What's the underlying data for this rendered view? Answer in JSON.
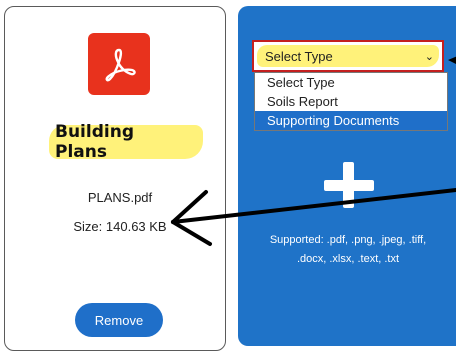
{
  "file_card": {
    "title": "Building Plans",
    "file_name": "PLANS.pdf",
    "file_size": "Size: 140.63 KB",
    "remove_label": "Remove",
    "icon": "pdf-acrobat-icon"
  },
  "upload": {
    "select": {
      "selected_value": "Select Type",
      "options": [
        "Select Type",
        "Soils Report",
        "Supporting Documents"
      ],
      "highlighted_index": 2
    },
    "icon": "plus-icon",
    "supported_line1": "Supported: .pdf, .png, .jpeg, .tiff,",
    "supported_line2": ".docx, .xlsx, .text, .txt"
  },
  "colors": {
    "panel_blue": "#1f73c8",
    "button_blue": "#1f6fc9",
    "pdf_red": "#e8321d",
    "highlight_yellow": "#fff27a",
    "select_border_red": "#c41f1f",
    "annotation_black": "#000000"
  }
}
